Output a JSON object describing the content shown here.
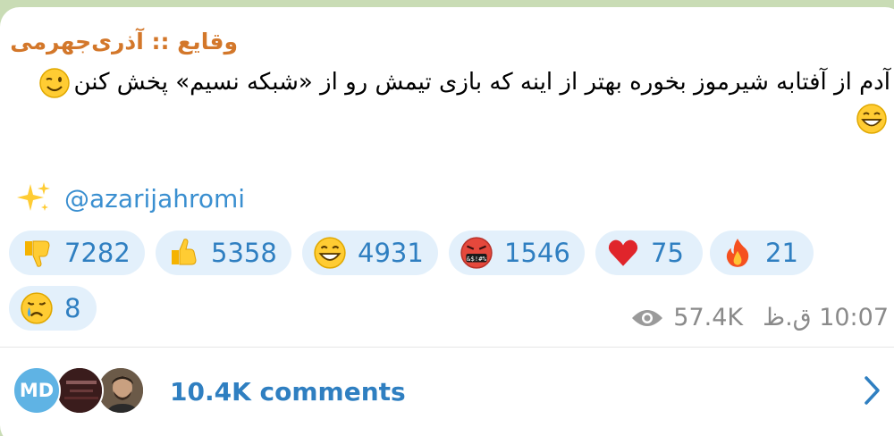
{
  "post": {
    "channel_name": "وقایع :: آذری‌جهرمی",
    "text": "آدم از آفتابه شیرموز بخوره بهتر از اینه که بازی تیمش رو از «شبکه نسیم» پخش کنن",
    "text_emojis": [
      "winking-face",
      "grinning-face"
    ],
    "signature_handle": "@azarijahromi",
    "signature_icon": "sparkles-icon"
  },
  "reactions": [
    {
      "emoji": "thumbs-down",
      "count": "7282"
    },
    {
      "emoji": "thumbs-up",
      "count": "5358"
    },
    {
      "emoji": "grinning-face",
      "count": "4931"
    },
    {
      "emoji": "cursing-face",
      "count": "1546"
    },
    {
      "emoji": "red-heart",
      "count": "75"
    },
    {
      "emoji": "fire",
      "count": "21"
    },
    {
      "emoji": "crying-face",
      "count": "8"
    }
  ],
  "meta": {
    "views": "57.4K",
    "time": "10:07 ق.ظ"
  },
  "comments": {
    "label": "10.4K comments",
    "avatars": [
      "MD",
      "channel-avatar",
      "user-avatar"
    ]
  },
  "colors": {
    "channel_name": "#d3772a",
    "accent": "#2f7fc1",
    "reaction_bg": "#e3f0fb",
    "meta": "#8a8a8a",
    "background": "#c9dcb5"
  }
}
